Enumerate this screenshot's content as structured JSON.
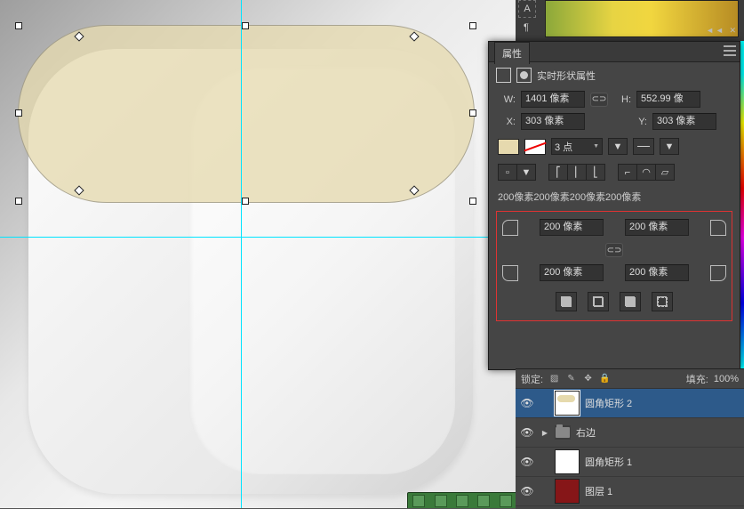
{
  "panel": {
    "tab": "属性",
    "title": "实时形状属性",
    "labels": {
      "W": "W:",
      "H": "H:",
      "X": "X:",
      "Y": "Y:"
    },
    "W": "1401 像素",
    "H": "552.99 像",
    "X": "303 像素",
    "Y": "303 像素",
    "strokeWidth": "3 点",
    "cornerSummary": "200像素200像素200像素200像素",
    "corners": {
      "tl": "200 像素",
      "tr": "200 像素",
      "bl": "200 像素",
      "br": "200 像素"
    }
  },
  "layers": {
    "lockLabel": "锁定:",
    "fillLabel": "填充:",
    "fillValue": "100%",
    "items": [
      {
        "name": "圆角矩形 2",
        "thumb": "beige",
        "selected": true
      },
      {
        "name": "右边",
        "thumb": "folder"
      },
      {
        "name": "圆角矩形 1",
        "thumb": "white"
      },
      {
        "name": "图层 1",
        "thumb": "red"
      }
    ]
  },
  "colors": {
    "shapeFill": "#e6d9ae",
    "highlight": "#d33",
    "selBlue": "#2d5a8a"
  }
}
